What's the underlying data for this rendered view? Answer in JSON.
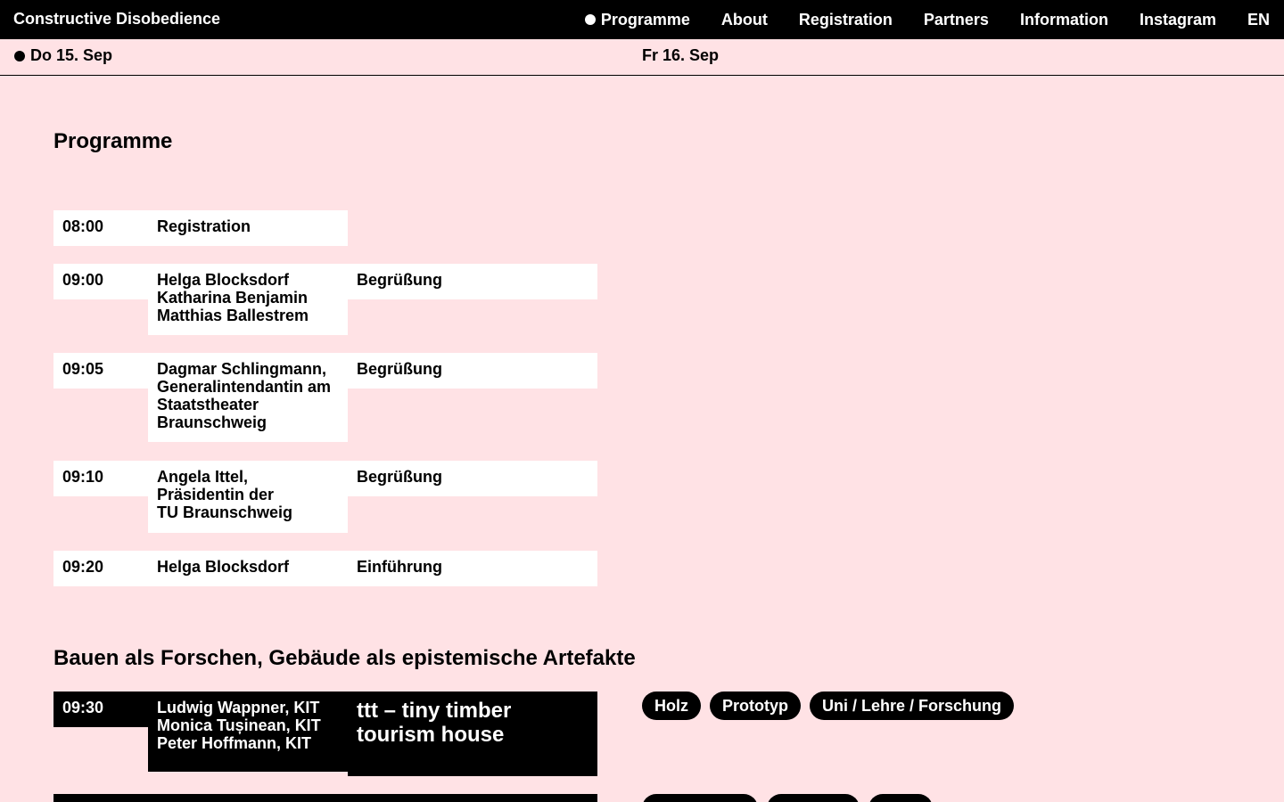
{
  "header": {
    "title": "Constructive Disobedience",
    "nav": [
      "Programme",
      "About",
      "Registration",
      "Partners",
      "Information",
      "Instagram",
      "EN"
    ]
  },
  "days": [
    "Do 15. Sep",
    "Fr 16. Sep"
  ],
  "page_title": "Programme",
  "rows": [
    {
      "time": "08:00",
      "who": "Registration",
      "what": ""
    },
    {
      "time": "09:00",
      "who": "Helga Blocksdorf\nKatharina Benjamin\nMatthias Ballestrem",
      "what": "Begrüßung"
    },
    {
      "time": "09:05",
      "who": "Dagmar Schlingmann,\nGeneralintendantin am\nStaatstheater\nBraunschweig",
      "what": "Begrüßung"
    },
    {
      "time": "09:10",
      "who": "Angela Ittel,\nPräsidentin der\nTU Braunschweig",
      "what": "Begrüßung"
    },
    {
      "time": "09:20",
      "who": "Helga Blocksdorf",
      "what": "Einführung"
    }
  ],
  "section": {
    "title": "Bauen als Forschen, Gebäude als epistemische Artefakte",
    "rows": [
      {
        "time": "09:30",
        "who": "Ludwig Wappner, KIT\nMonica Tușinean, KIT\nPeter Hoffmann, KIT",
        "what": "ttt – tiny timber\ntourism house",
        "tags": [
          "Holz",
          "Prototyp",
          "Uni / Lehre / Forschung"
        ]
      }
    ]
  }
}
